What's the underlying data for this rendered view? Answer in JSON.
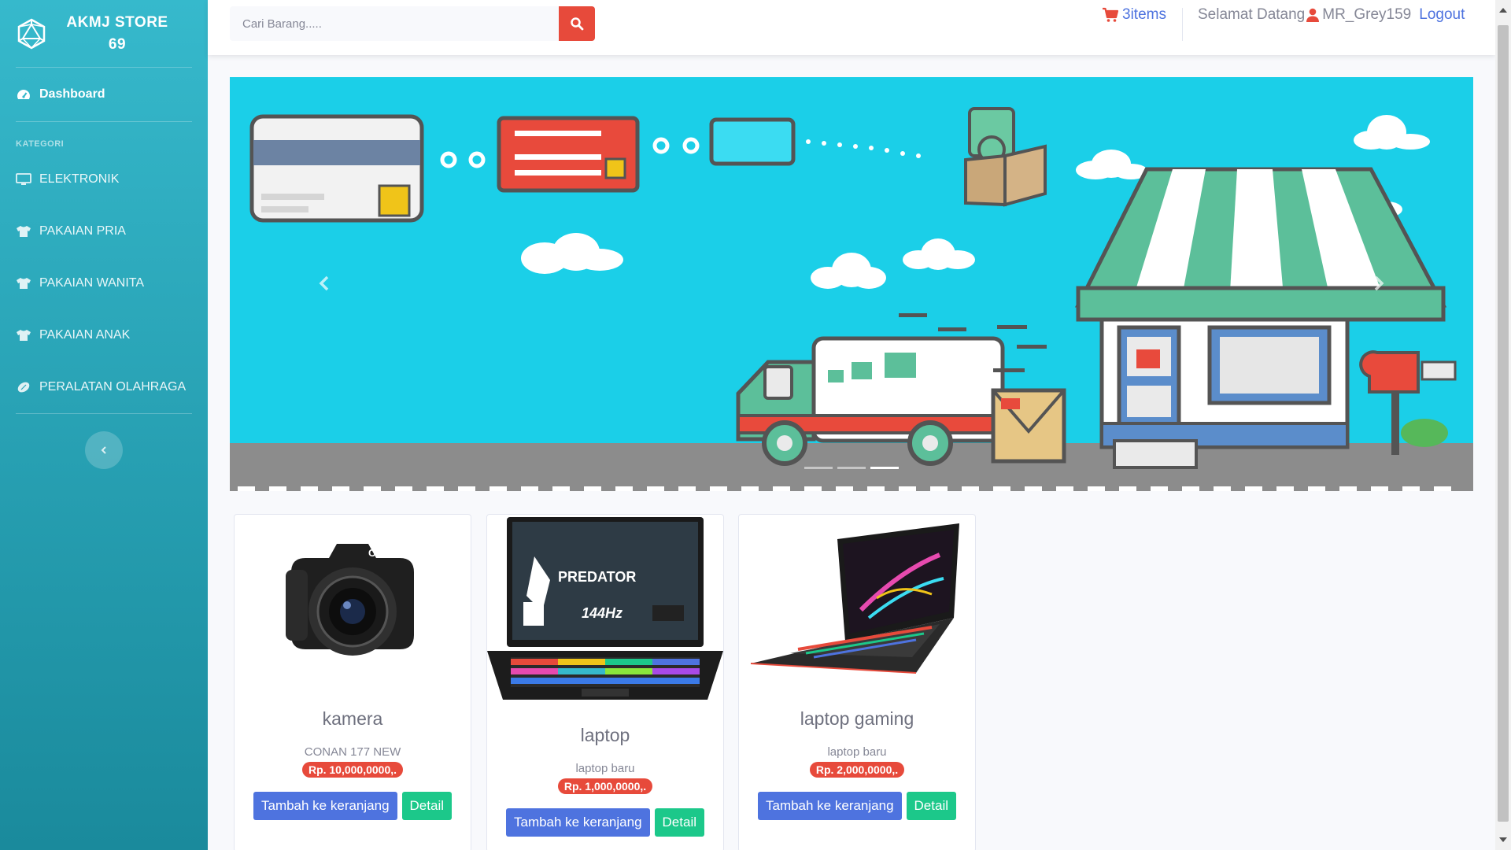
{
  "brand": {
    "line1": "AKMJ STORE",
    "line2": "69"
  },
  "sidebar": {
    "dashboard": "Dashboard",
    "heading": "KATEGORI",
    "items": [
      {
        "label": "ELEKTRONIK",
        "icon": "monitor-icon"
      },
      {
        "label": "PAKAIAN PRIA",
        "icon": "shirt-icon"
      },
      {
        "label": "PAKAIAN WANITA",
        "icon": "shirt-icon"
      },
      {
        "label": "PAKAIAN ANAK",
        "icon": "shirt-icon"
      },
      {
        "label": "PERALATAN OLAHRAGA",
        "icon": "football-icon"
      }
    ]
  },
  "topbar": {
    "search_placeholder": "Cari Barang.....",
    "cart_count": "3items",
    "welcome": "Selamat Datang",
    "username": "MR_Grey159",
    "logout": "Logout"
  },
  "carousel": {
    "slide_count": 3,
    "active_index": 2
  },
  "products": [
    {
      "name": "kamera",
      "desc": "CONAN 177 NEW",
      "price": "Rp. 10,000,0000,.",
      "add_label": "Tambah ke keranjang",
      "detail_label": "Detail"
    },
    {
      "name": "laptop",
      "desc": "laptop baru",
      "price": "Rp. 1,000,0000,.",
      "add_label": "Tambah ke keranjang",
      "detail_label": "Detail"
    },
    {
      "name": "laptop gaming",
      "desc": "laptop baru",
      "price": "Rp. 2,000,0000,.",
      "add_label": "Tambah ke keranjang",
      "detail_label": "Detail"
    }
  ],
  "colors": {
    "sidebar_top": "#36b9cc",
    "sidebar_bottom": "#1a8a9c",
    "primary": "#4e73df",
    "success": "#1cc88a",
    "danger": "#e74a3b",
    "banner_sky": "#1bcfe8"
  }
}
